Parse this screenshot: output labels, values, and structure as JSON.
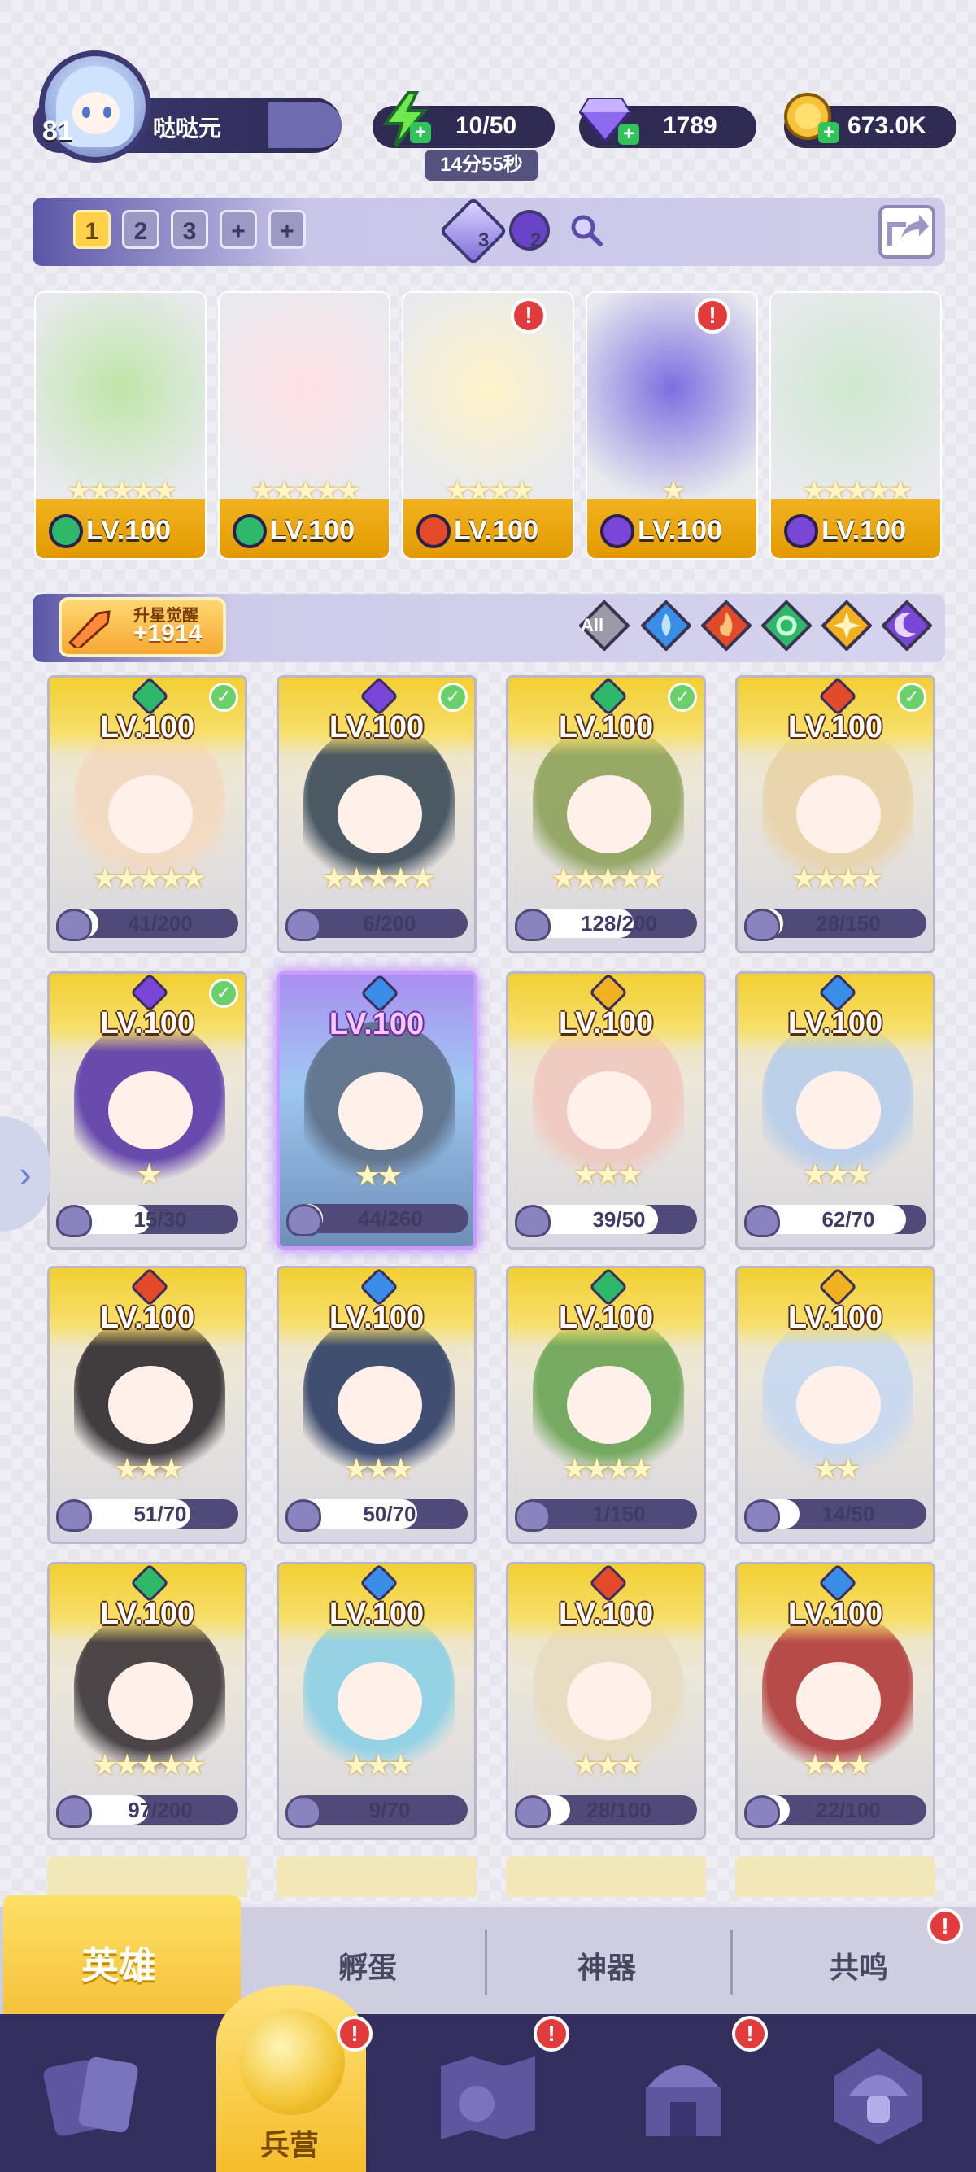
{
  "player": {
    "level": "81",
    "name": "哒哒元"
  },
  "resources": {
    "energy": "10/50",
    "energy_timer": "14分55秒",
    "gems": "1789",
    "coins": "673.0K"
  },
  "team_bar": {
    "tabs": [
      "1",
      "2",
      "3",
      "+",
      "+"
    ],
    "active_tab": "1",
    "counter_a": "3",
    "counter_b": "2"
  },
  "team": [
    {
      "element": "green",
      "stars": "★★★★★",
      "level": "LV.100",
      "alert": false
    },
    {
      "element": "green",
      "stars": "★★★★★",
      "level": "LV.100",
      "alert": false
    },
    {
      "element": "red",
      "stars": "★★★★",
      "level": "LV.100",
      "alert": true
    },
    {
      "element": "purple",
      "stars": "★",
      "level": "LV.100",
      "alert": true
    },
    {
      "element": "purple",
      "stars": "★★★★★",
      "level": "LV.100",
      "alert": false
    }
  ],
  "awaken": {
    "label": "升星觉醒",
    "value": "+1914"
  },
  "filters": {
    "all_label": "All"
  },
  "heroes": [
    {
      "level": "LV.100",
      "element": "green",
      "checked": true,
      "stars": "★★★★★",
      "progress": "41/200",
      "ratio": 0.205,
      "tone": "#f3d9c0"
    },
    {
      "level": "LV.100",
      "element": "purple",
      "checked": true,
      "stars": "★★★★★",
      "progress": "6/200",
      "ratio": 0.03,
      "tone": "#3b4a57"
    },
    {
      "level": "LV.100",
      "element": "green",
      "checked": true,
      "stars": "★★★★★",
      "progress": "128/200",
      "ratio": 0.64,
      "tone": "#8ca25a"
    },
    {
      "level": "LV.100",
      "element": "red",
      "checked": true,
      "stars": "★★★★",
      "progress": "28/150",
      "ratio": 0.187,
      "tone": "#e8d3a8"
    },
    {
      "level": "LV.100",
      "element": "purple",
      "checked": true,
      "stars": "★",
      "progress": "15/30",
      "ratio": 0.5,
      "tone": "#5a3aa8"
    },
    {
      "level": "LV.100",
      "element": "blue",
      "checked": false,
      "stars": "★★",
      "progress": "44/260",
      "ratio": 0.169,
      "tone": "#5d6f86",
      "selected": true
    },
    {
      "level": "LV.100",
      "element": "yellow",
      "checked": false,
      "stars": "★★★",
      "progress": "39/50",
      "ratio": 0.78,
      "tone": "#f0c8c0"
    },
    {
      "level": "LV.100",
      "element": "blue",
      "checked": false,
      "stars": "★★★",
      "progress": "62/70",
      "ratio": 0.886,
      "tone": "#b7cdeb"
    },
    {
      "level": "LV.100",
      "element": "red",
      "checked": false,
      "stars": "★★★",
      "progress": "51/70",
      "ratio": 0.729,
      "tone": "#2e2a2e"
    },
    {
      "level": "LV.100",
      "element": "blue",
      "checked": false,
      "stars": "★★★",
      "progress": "50/70",
      "ratio": 0.714,
      "tone": "#2d3d66"
    },
    {
      "level": "LV.100",
      "element": "green",
      "checked": false,
      "stars": "★★★★",
      "progress": "1/150",
      "ratio": 0.007,
      "tone": "#6aa454"
    },
    {
      "level": "LV.100",
      "element": "yellow",
      "checked": false,
      "stars": "★★",
      "progress": "14/50",
      "ratio": 0.28,
      "tone": "#c7d8f0"
    },
    {
      "level": "LV.100",
      "element": "green",
      "checked": false,
      "stars": "★★★★★",
      "progress": "97/200",
      "ratio": 0.485,
      "tone": "#3a3438"
    },
    {
      "level": "LV.100",
      "element": "blue",
      "checked": false,
      "stars": "★★★",
      "progress": "9/70",
      "ratio": 0.129,
      "tone": "#8ad0e6"
    },
    {
      "level": "LV.100",
      "element": "red",
      "checked": false,
      "stars": "★★★",
      "progress": "28/100",
      "ratio": 0.28,
      "tone": "#e8dcc0"
    },
    {
      "level": "LV.100",
      "element": "blue",
      "checked": false,
      "stars": "★★★",
      "progress": "22/100",
      "ratio": 0.22,
      "tone": "#b03a3a"
    }
  ],
  "sub_tabs": [
    "英雄",
    "孵蛋",
    "神器",
    "共鸣"
  ],
  "nav": {
    "barracks_label": "兵营"
  },
  "colors": {
    "green": "#2fb86a",
    "red": "#e24a2a",
    "purple": "#7a46d8",
    "blue": "#3a8ee8",
    "yellow": "#f0b020"
  }
}
